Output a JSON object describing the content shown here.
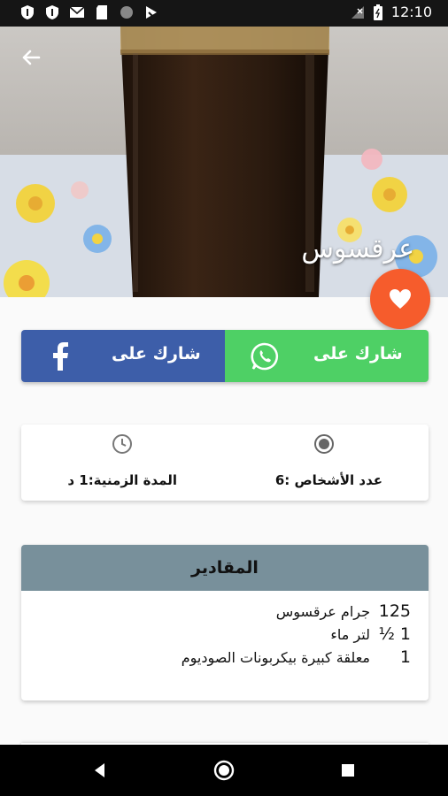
{
  "status_bar": {
    "time": "12:10",
    "icons": [
      "shield-icon",
      "shield-icon",
      "gmail-icon",
      "sd-card-icon",
      "circle-icon",
      "feed-icon",
      "no-signal-icon",
      "battery-icon"
    ]
  },
  "recipe": {
    "title": "عرقسوس"
  },
  "share": {
    "facebook_label": "شارك على",
    "whatsapp_label": "شارك على"
  },
  "info": {
    "people": "عدد الأشخاص :6",
    "duration": "المدة الزمنية:1 د"
  },
  "ingredients": {
    "title": "المقادير",
    "items": [
      {
        "qty": "125",
        "name": "جرام عرقسوس"
      },
      {
        "qty": "1 ½",
        "name": "لتر ماء"
      },
      {
        "qty": "1",
        "name": "معلقة كبيرة بيكربونات الصوديوم"
      }
    ]
  },
  "colors": {
    "accent": "#f65c2c",
    "facebook": "#3d5ea9",
    "whatsapp": "#4ed065",
    "header": "#78909b"
  }
}
